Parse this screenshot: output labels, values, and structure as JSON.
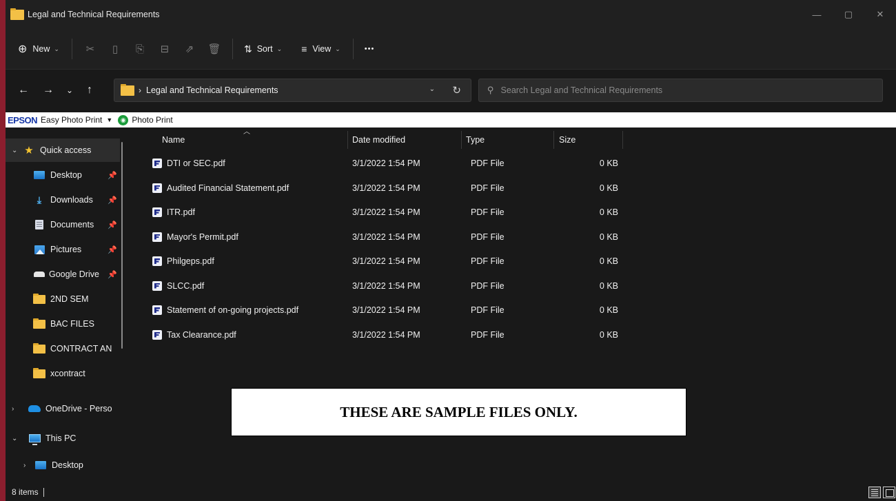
{
  "window": {
    "title": "Legal and Technical Requirements",
    "controls": {
      "minimize": "—",
      "maximize": "▢",
      "close": "✕"
    }
  },
  "commandbar": {
    "new_label": "New",
    "sort_label": "Sort",
    "view_label": "View",
    "more_label": "•••",
    "icons": [
      "cut-icon",
      "copy-icon",
      "paste-icon",
      "rename-icon",
      "share-icon",
      "delete-icon"
    ]
  },
  "address": {
    "crumb": "Legal and Technical Requirements",
    "search_placeholder": "Search Legal and Technical Requirements"
  },
  "epson": {
    "brand": "EPSON",
    "app": "Easy Photo Print",
    "photo_print": "Photo Print"
  },
  "sidebar": {
    "items": [
      {
        "label": "Quick access",
        "icon": "star-icon",
        "expander": "⌄"
      },
      {
        "label": "Desktop",
        "icon": "desktop-icon",
        "pinned": true
      },
      {
        "label": "Downloads",
        "icon": "downloads-icon",
        "pinned": true
      },
      {
        "label": "Documents",
        "icon": "documents-icon",
        "pinned": true
      },
      {
        "label": "Pictures",
        "icon": "pictures-icon",
        "pinned": true
      },
      {
        "label": "Google Drive",
        "icon": "drive-icon",
        "pinned": true
      },
      {
        "label": "2ND SEM",
        "icon": "folder-icon"
      },
      {
        "label": "BAC FILES",
        "icon": "folder-icon"
      },
      {
        "label": "CONTRACT AN",
        "icon": "folder-icon"
      },
      {
        "label": "xcontract",
        "icon": "folder-icon"
      },
      {
        "label": "OneDrive - Perso",
        "icon": "onedrive-icon",
        "expander": "›"
      },
      {
        "label": "This PC",
        "icon": "pc-icon",
        "expander": "⌄"
      },
      {
        "label": "Desktop",
        "icon": "desktop-icon",
        "expander": "›"
      }
    ]
  },
  "table": {
    "columns": {
      "name": "Name",
      "date": "Date modified",
      "type": "Type",
      "size": "Size"
    },
    "rows": [
      {
        "name": "DTI or SEC.pdf",
        "date": "3/1/2022 1:54 PM",
        "type": "PDF File",
        "size": "0 KB"
      },
      {
        "name": "Audited Financial Statement.pdf",
        "date": "3/1/2022 1:54 PM",
        "type": "PDF File",
        "size": "0 KB"
      },
      {
        "name": "ITR.pdf",
        "date": "3/1/2022 1:54 PM",
        "type": "PDF File",
        "size": "0 KB"
      },
      {
        "name": "Mayor's Permit.pdf",
        "date": "3/1/2022 1:54 PM",
        "type": "PDF File",
        "size": "0 KB"
      },
      {
        "name": "Philgeps.pdf",
        "date": "3/1/2022 1:54 PM",
        "type": "PDF File",
        "size": "0 KB"
      },
      {
        "name": "SLCC.pdf",
        "date": "3/1/2022 1:54 PM",
        "type": "PDF File",
        "size": "0 KB"
      },
      {
        "name": "Statement of on-going projects.pdf",
        "date": "3/1/2022 1:54 PM",
        "type": "PDF File",
        "size": "0 KB"
      },
      {
        "name": "Tax Clearance.pdf",
        "date": "3/1/2022 1:54 PM",
        "type": "PDF File",
        "size": "0 KB"
      }
    ]
  },
  "notice": "THESE ARE SAMPLE FILES ONLY.",
  "status": {
    "count": "8 items"
  },
  "colors": {
    "accent": "#8b1e2e",
    "background": "#191919",
    "folder": "#f3c046"
  }
}
